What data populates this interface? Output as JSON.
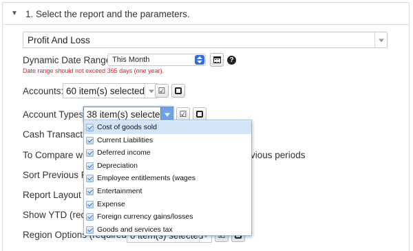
{
  "section": {
    "caret_icon": "triangle-down-icon",
    "title": "1. Select the report and the parameters."
  },
  "report": {
    "selected": "Profit And Loss"
  },
  "date_range": {
    "label": "Dynamic Date Range:",
    "value": "This Month",
    "warning": "Date range should not exceed 365 days (one year).",
    "warning_color": "#d9202a"
  },
  "accounts": {
    "label": "Accounts:",
    "value": "60 item(s) selected"
  },
  "account_types": {
    "label": "Account Types:",
    "value": "38 item(s) selected",
    "options": [
      {
        "label": "Cost of goods sold",
        "checked": true
      },
      {
        "label": "Current Liabilities",
        "checked": true
      },
      {
        "label": "Deferred income",
        "checked": true
      },
      {
        "label": "Depreciation",
        "checked": true
      },
      {
        "label": "Employee entitlements (wages",
        "checked": true
      },
      {
        "label": "Entertainment",
        "checked": true
      },
      {
        "label": "Expense",
        "checked": true
      },
      {
        "label": "Foreign currency gains/losses",
        "checked": true
      },
      {
        "label": "Goods and services tax",
        "checked": true
      }
    ]
  },
  "obscured_rows": {
    "cash": "Cash Transactio",
    "compare_left": "To Compare wit",
    "compare_right": "vious periods",
    "sort": "Sort Previous Pe",
    "layout": "Report Layout (",
    "ytd": "Show YTD (requ",
    "region_label": "Region Options (required):",
    "region_value": "0 item(s) selected"
  },
  "accent_color": "#2e6ee8"
}
